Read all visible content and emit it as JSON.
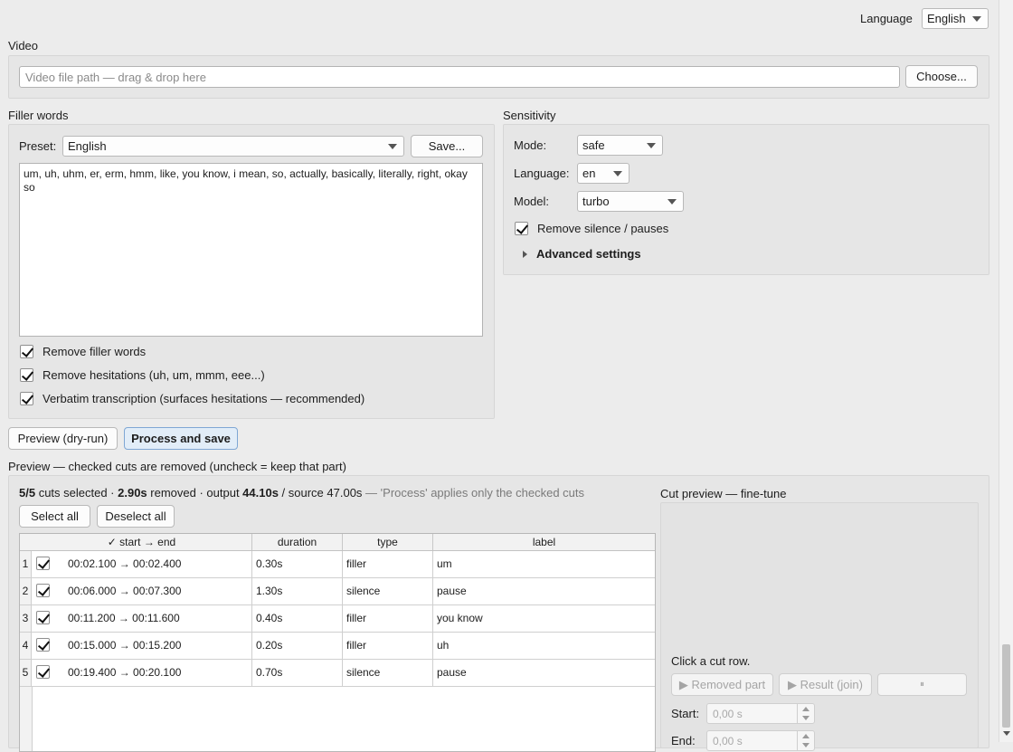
{
  "header": {
    "language_label": "Language",
    "language_value": "English"
  },
  "video": {
    "group_title": "Video",
    "path_placeholder": "Video file path — drag & drop here",
    "path_value": "",
    "choose_label": "Choose..."
  },
  "filler": {
    "group_title": "Filler words",
    "preset_label": "Preset:",
    "preset_value": "English",
    "save_label": "Save...",
    "words_text": "um, uh, uhm, er, erm, hmm, like, you know, i mean, so, actually, basically, literally, right, okay so",
    "opt_remove_filler": "Remove filler words",
    "opt_remove_hesitations": "Remove hesitations (uh, um, mmm, eee...)",
    "opt_verbatim": "Verbatim transcription (surfaces hesitations — recommended)"
  },
  "sensitivity": {
    "group_title": "Sensitivity",
    "mode_label": "Mode:",
    "mode_value": "safe",
    "language_label": "Language:",
    "language_value": "en",
    "model_label": "Model:",
    "model_value": "turbo",
    "opt_remove_silence": "Remove silence / pauses",
    "advanced_label": "Advanced settings"
  },
  "actions": {
    "preview_label": "Preview (dry-run)",
    "process_label": "Process and save"
  },
  "preview": {
    "group_title": "Preview — checked cuts are removed (uncheck = keep that part)",
    "summary": {
      "selected": "5/5",
      "cuts_text": " cuts selected · ",
      "removed": "2.90s",
      "removed_text": " removed · output ",
      "output": "44.10s",
      "source_text": " / source 47.00s",
      "note": " — 'Process' applies only the checked cuts"
    },
    "select_all": "Select all",
    "deselect_all": "Deselect all",
    "columns": {
      "range": "✓ start → end",
      "duration": "duration",
      "type": "type",
      "label": "label"
    },
    "rows": [
      {
        "num": "1",
        "range": "00:02.100 → 00:02.400",
        "duration": "0.30s",
        "type": "filler",
        "label": "um"
      },
      {
        "num": "2",
        "range": "00:06.000 → 00:07.300",
        "duration": "1.30s",
        "type": "silence",
        "label": "pause"
      },
      {
        "num": "3",
        "range": "00:11.200 → 00:11.600",
        "duration": "0.40s",
        "type": "filler",
        "label": "you know"
      },
      {
        "num": "4",
        "range": "00:15.000 → 00:15.200",
        "duration": "0.20s",
        "type": "filler",
        "label": "uh"
      },
      {
        "num": "5",
        "range": "00:19.400 → 00:20.100",
        "duration": "0.70s",
        "type": "silence",
        "label": "pause"
      }
    ]
  },
  "cut_preview": {
    "group_title": "Cut preview — fine-tune",
    "hint": "Click a cut row.",
    "removed_part": "▶ Removed part",
    "result_join": "▶ Result (join)",
    "pause_icon": "⏸",
    "start_label": "Start:",
    "start_value": "0,00 s",
    "end_label": "End:",
    "end_value": "0,00 s"
  }
}
